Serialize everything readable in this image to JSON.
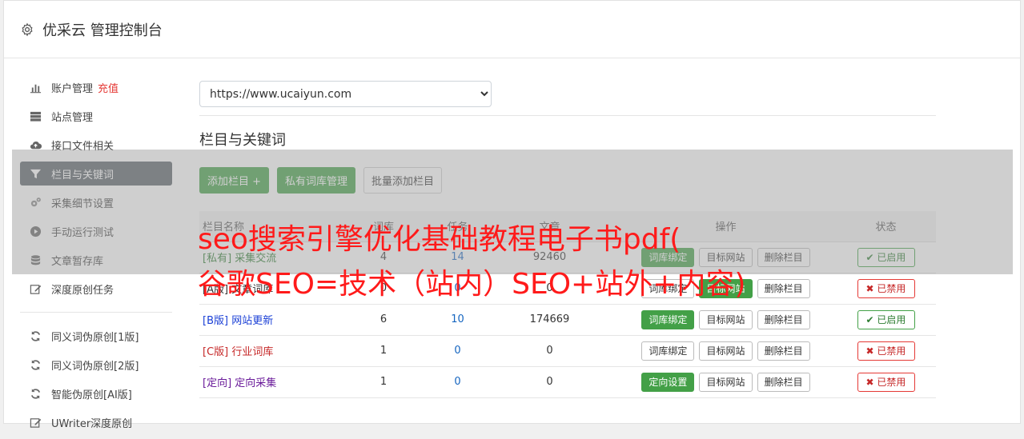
{
  "header": {
    "title": "优采云 管理控制台"
  },
  "sidebar": {
    "items": [
      {
        "label": "账户管理",
        "extra": "充值",
        "icon": "bar-chart-icon"
      },
      {
        "label": "站点管理",
        "icon": "server-icon"
      },
      {
        "label": "接口文件相关",
        "icon": "cloud-upload-icon"
      },
      {
        "label": "栏目与关键词",
        "icon": "filter-icon"
      },
      {
        "label": "采集细节设置",
        "icon": "gears-icon"
      },
      {
        "label": "手动运行测试",
        "icon": "play-circle-icon"
      },
      {
        "label": "文章暂存库",
        "icon": "database-icon"
      },
      {
        "label": "深度原创任务",
        "icon": "edit-icon"
      }
    ],
    "items2": [
      {
        "label": "同义词伪原创[1版]",
        "icon": "refresh-icon"
      },
      {
        "label": "同义词伪原创[2版]",
        "icon": "refresh-icon"
      },
      {
        "label": "智能伪原创[AI版]",
        "icon": "refresh-icon"
      },
      {
        "label": "UWriter深度原创",
        "icon": "edit-icon"
      }
    ]
  },
  "site_select": {
    "value": "https://www.ucaiyun.com"
  },
  "section": {
    "title": "栏目与关键词"
  },
  "buttons": {
    "add": "添加栏目 +",
    "private_lib": "私有词库管理",
    "batch_add": "批量添加栏目"
  },
  "table": {
    "headers": [
      "栏目名称",
      "词库",
      "任务",
      "文章",
      "操作",
      "状态"
    ],
    "rows": [
      {
        "tag": "[私有]",
        "name": "采集交流",
        "c1": "4",
        "c2": "14",
        "c3": "92460",
        "bind": "词库绑定",
        "target": "目标网站",
        "del": "删除栏目",
        "status": "已启用"
      },
      {
        "tag": "[A版]",
        "name": "文章词库",
        "c1": "0",
        "c2": "0",
        "c3": "0",
        "bind": "词库绑定",
        "target": "目标网站",
        "del": "删除栏目",
        "status": "已禁用"
      },
      {
        "tag": "[B版]",
        "name": "网站更新",
        "c1": "6",
        "c2": "10",
        "c3": "174669",
        "bind": "词库绑定",
        "target": "目标网站",
        "del": "删除栏目",
        "status": "已启用"
      },
      {
        "tag": "[C版]",
        "name": "行业词库",
        "c1": "1",
        "c2": "0",
        "c3": "0",
        "bind": "词库绑定",
        "target": "目标网站",
        "del": "删除栏目",
        "status": "已禁用"
      },
      {
        "tag": "[定向]",
        "name": "定向采集",
        "c1": "1",
        "c2": "0",
        "c3": "0",
        "bind": "定向设置",
        "target": "目标网站",
        "del": "删除栏目",
        "status": "已禁用"
      }
    ]
  },
  "banner": {
    "line1": "seo搜索引擎优化基础教程电子书pdf(",
    "line2": "谷歌SEO=技术（站内）SEO+站外+内容)"
  },
  "colors": {
    "accent_green": "#43a047",
    "active_sidebar": "#5a6268",
    "danger": "#e53935",
    "banner_red": "#ff1a1a"
  }
}
